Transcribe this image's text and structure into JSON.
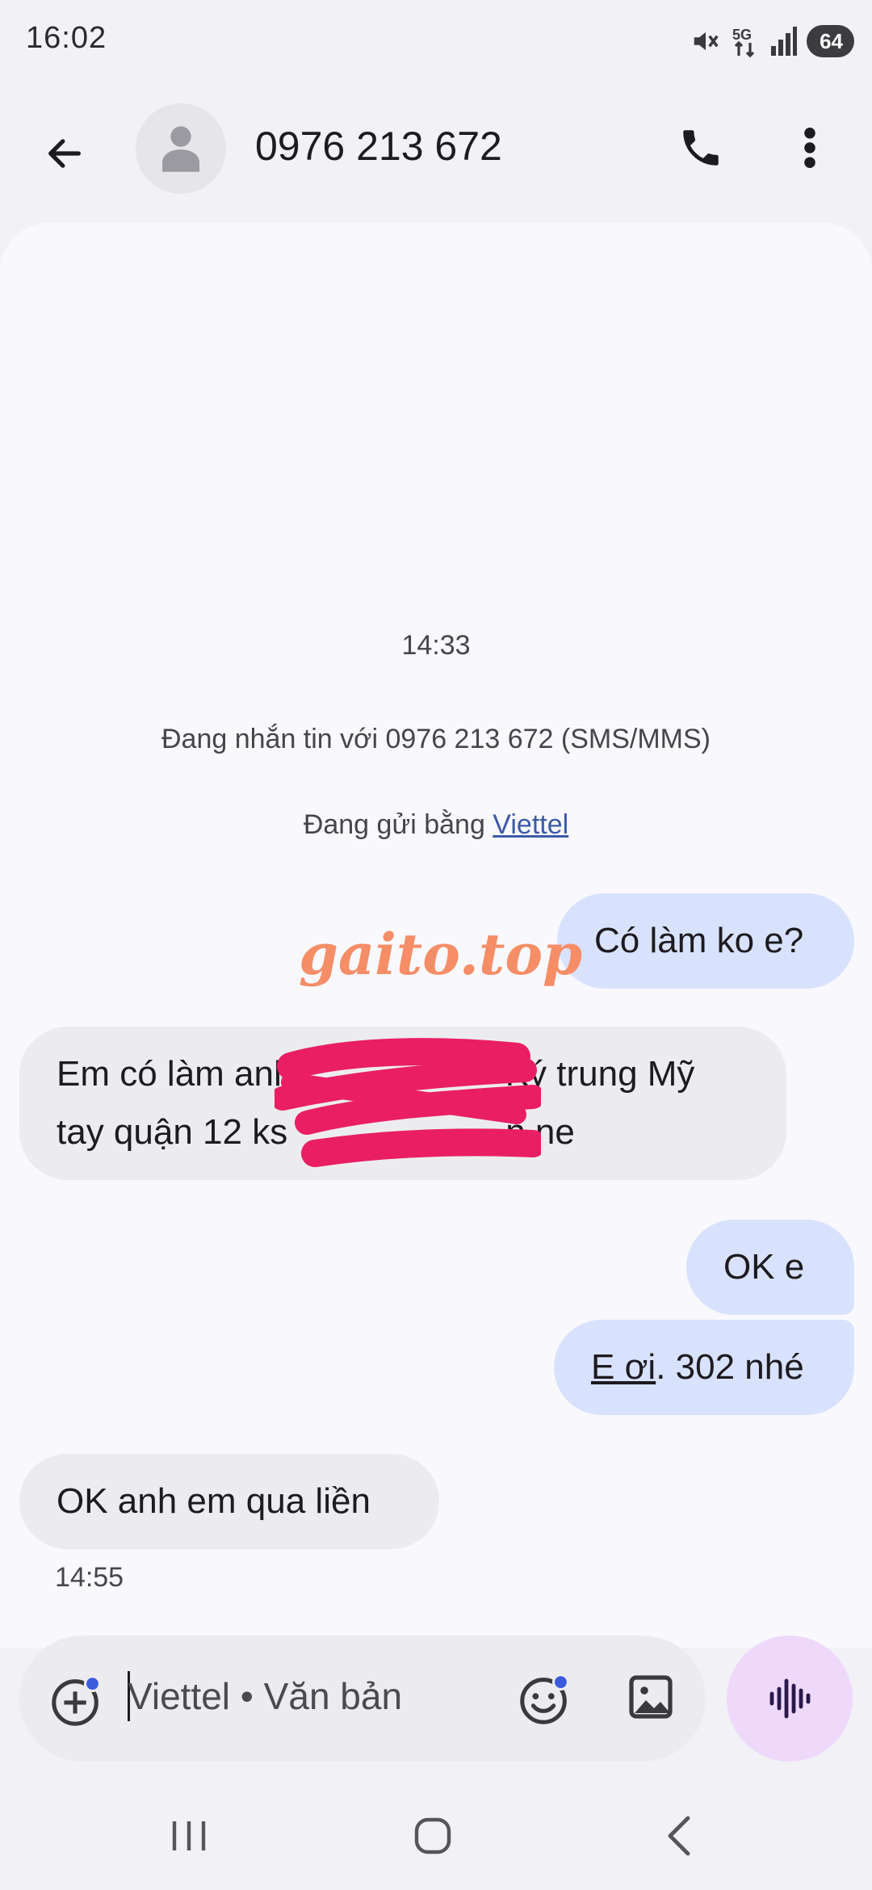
{
  "status_bar": {
    "time": "16:02",
    "network": "5G",
    "battery": "64"
  },
  "app_bar": {
    "contact_name": "0976 213 672",
    "icons": [
      "back-arrow-icon",
      "person-icon",
      "phone-icon",
      "more-vert-icon"
    ]
  },
  "conversation": {
    "timestamp_top": "14:33",
    "info_text": "Đang nhắn tin với 0976 213 672 (SMS/MMS)",
    "sending_prefix": "Đang gửi bằng ",
    "sending_carrier": "Viettel",
    "messages": [
      {
        "direction": "outgoing",
        "text": "Có làm ko e?"
      },
      {
        "direction": "incoming",
        "line1_a": "Em có làm anh ",
        "line1_b": "Ký trung Mỹ",
        "line2_a": "tay quận 12 ks",
        "line2_b": "n ne"
      },
      {
        "direction": "outgoing",
        "text": "OK e"
      },
      {
        "direction": "outgoing",
        "text_underlined": "E ơi",
        "text_rest": ". 302 nhé"
      },
      {
        "direction": "incoming",
        "text": "OK anh em qua liền"
      }
    ],
    "timestamp_bottom": "14:55",
    "watermark": "gaito.top"
  },
  "composer": {
    "placeholder": "Viettel • Văn bản"
  },
  "colors": {
    "outgoing_bubble": "#d9e2fd",
    "incoming_bubble": "#ececef",
    "voice_button": "#efd9fb",
    "redaction": "#e91e63",
    "watermark": "#f58d66"
  }
}
